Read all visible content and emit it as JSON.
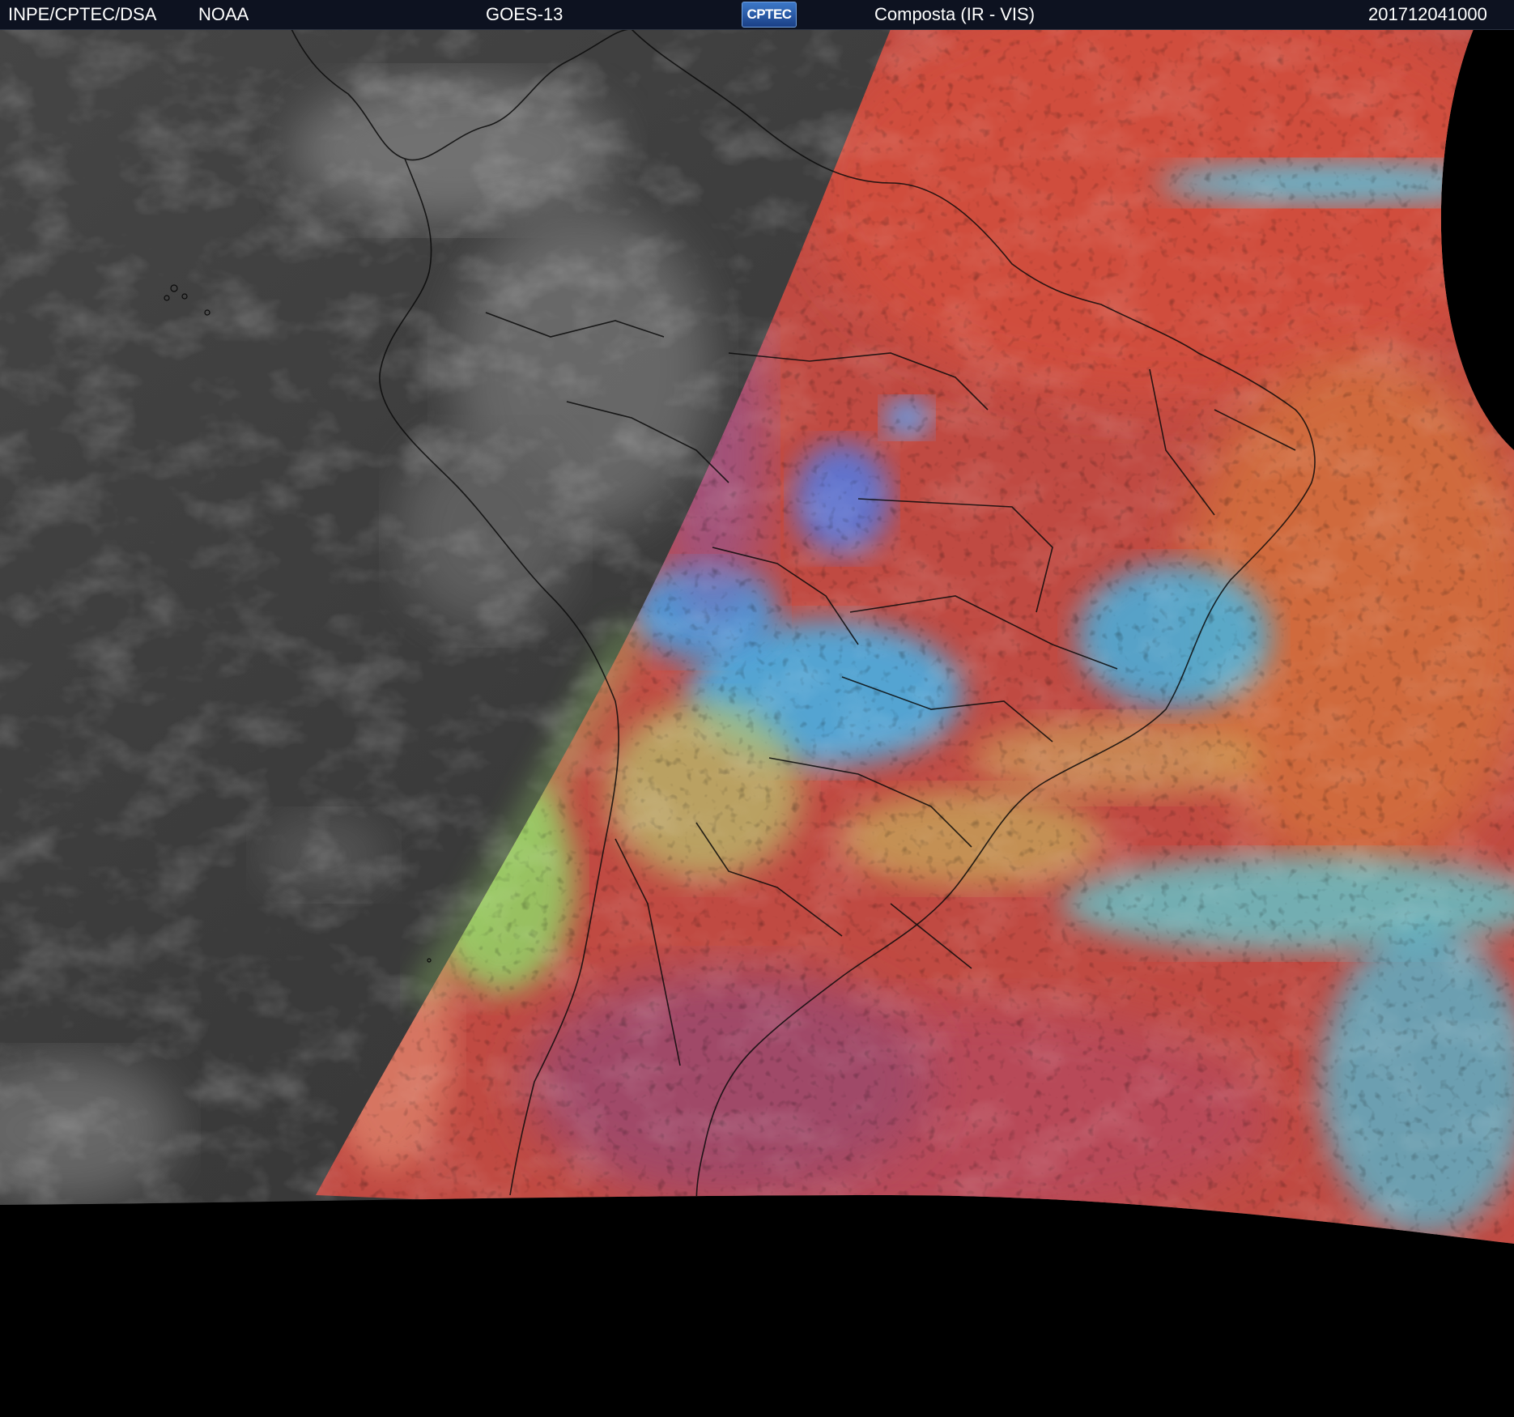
{
  "header": {
    "agency": "INPE/CPTEC/DSA",
    "partner": "NOAA",
    "satellite": "GOES-13",
    "logo_text": "CPTEC",
    "product": "Composta (IR - VIS)",
    "timestamp": "201712041000"
  },
  "colors": {
    "header_bg": "#0d1220",
    "header_text": "#ffffff",
    "night_side": "#3a3a3a",
    "composite_land": "#c24a40",
    "cloud_cyan": "#39b9e0",
    "cloud_green": "#8fd86a",
    "no_data": "#000000"
  }
}
